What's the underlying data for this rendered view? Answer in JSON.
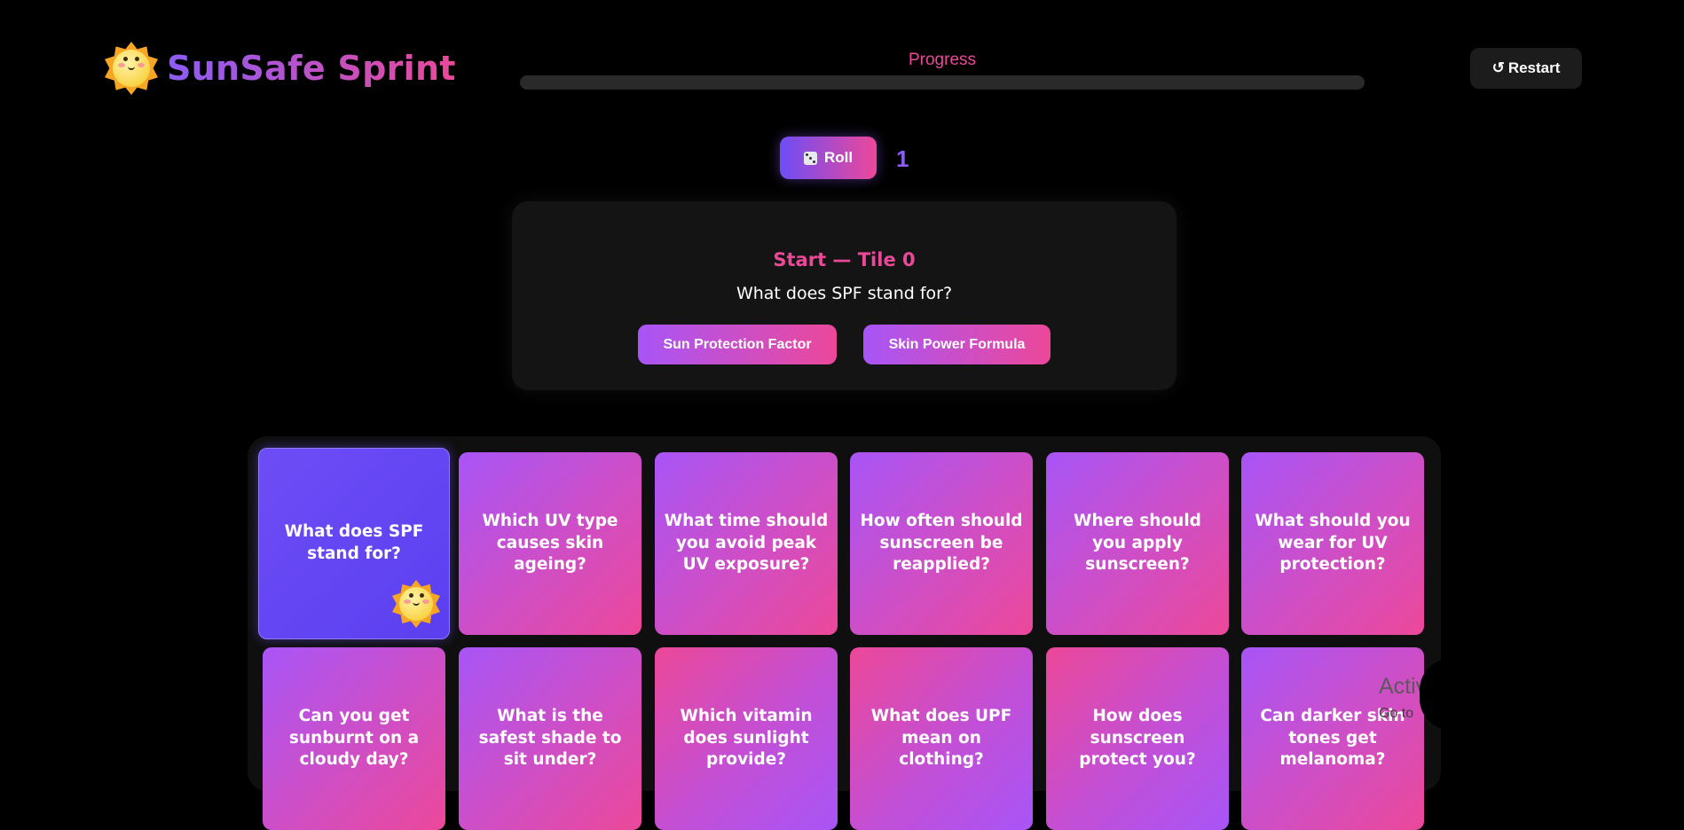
{
  "header": {
    "brand": "SunSafe Sprint",
    "logo_icon": "sun-mascot-icon",
    "progress_label": "Progress",
    "progress_fraction": 0,
    "restart_icon": "↺",
    "restart_label": "Restart"
  },
  "dice": {
    "roll_label": "Roll",
    "roll_icon": "dice-icon",
    "value": "1"
  },
  "question_card": {
    "title": "Start — Tile 0",
    "question": "What does SPF stand for?",
    "answers": [
      "Sun Protection Factor",
      "Skin Power Formula"
    ]
  },
  "board": {
    "tiles": [
      "What does SPF stand for?",
      "Which UV type causes skin ageing?",
      "What time should you avoid peak UV exposure?",
      "How often should sunscreen be reapplied?",
      "Where should you apply sunscreen?",
      "What should you wear for UV protection?",
      "Can you get sunburnt on a cloudy day?",
      "What is the safest shade to sit under?",
      "Which vitamin does sunlight provide?",
      "What does UPF mean on clothing?",
      "How does sunscreen protect you?",
      "Can darker skin tones get melanoma?"
    ],
    "current_tile": 0
  },
  "overlay": {
    "watermark": "Activ",
    "watermark_sub": "Go to"
  },
  "colors": {
    "accent_purple": "#8b5cf6",
    "accent_pink": "#ec4899",
    "background": "#000000"
  }
}
